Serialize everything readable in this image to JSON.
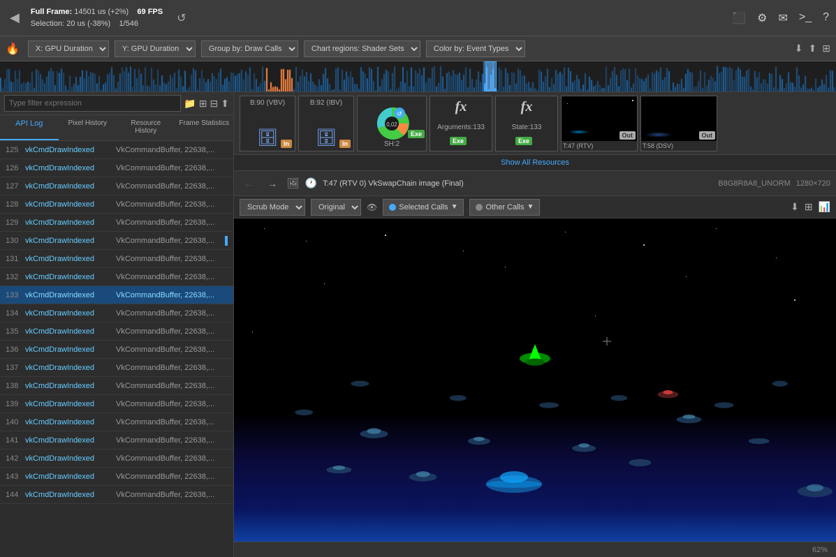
{
  "toolbar": {
    "back_icon": "◀",
    "full_frame_label": "Full Frame:",
    "full_frame_value": "14501 us (+2%)",
    "fps_value": "69 FPS",
    "selection_label": "Selection:",
    "selection_value": "20 us (-38%)",
    "frame_count": "1/546",
    "reset_icon": "↺",
    "icons": [
      "⬜",
      "⚙",
      "✉",
      "▶",
      "?"
    ]
  },
  "axis_toolbar": {
    "flame_icon": "🔥",
    "x_label": "X: GPU Duration",
    "y_label": "Y: GPU Duration",
    "group_label": "Group by: Draw Calls",
    "chart_label": "Chart regions: Shader Sets",
    "color_label": "Color by: Event Types",
    "export_icons": [
      "⬇",
      "⬇",
      "⬜"
    ]
  },
  "left_panel": {
    "filter_placeholder": "Type filter expression",
    "filter_icons": [
      "📁",
      "⊞",
      "⊟",
      "⬆"
    ],
    "tabs": [
      {
        "label": "API Log",
        "active": true
      },
      {
        "label": "Pixel History",
        "active": false
      },
      {
        "label": "Resource History",
        "active": false
      },
      {
        "label": "Frame Statistics",
        "active": false
      }
    ],
    "rows": [
      {
        "num": "125",
        "cmd": "vkCmdDrawIndexed",
        "args": "VkCommandBuffer, 22638,...",
        "selected": false
      },
      {
        "num": "126",
        "cmd": "vkCmdDrawIndexed",
        "args": "VkCommandBuffer, 22638,...",
        "selected": false
      },
      {
        "num": "127",
        "cmd": "vkCmdDrawIndexed",
        "args": "VkCommandBuffer, 22638,...",
        "selected": false
      },
      {
        "num": "128",
        "cmd": "vkCmdDrawIndexed",
        "args": "VkCommandBuffer, 22638,...",
        "selected": false
      },
      {
        "num": "129",
        "cmd": "vkCmdDrawIndexed",
        "args": "VkCommandBuffer, 22638,...",
        "selected": false
      },
      {
        "num": "130",
        "cmd": "vkCmdDrawIndexed",
        "args": "VkCommandBuffer, 22638,...",
        "selected": false
      },
      {
        "num": "131",
        "cmd": "vkCmdDrawIndexed",
        "args": "VkCommandBuffer, 22638,...",
        "selected": false
      },
      {
        "num": "132",
        "cmd": "vkCmdDrawIndexed",
        "args": "VkCommandBuffer, 22638,...",
        "selected": false
      },
      {
        "num": "133",
        "cmd": "vkCmdDrawIndexed",
        "args": "VkCommandBuffer, 22638,...",
        "selected": true
      },
      {
        "num": "134",
        "cmd": "vkCmdDrawIndexed",
        "args": "VkCommandBuffer, 22638,...",
        "selected": false
      },
      {
        "num": "135",
        "cmd": "vkCmdDrawIndexed",
        "args": "VkCommandBuffer, 22638,...",
        "selected": false
      },
      {
        "num": "136",
        "cmd": "vkCmdDrawIndexed",
        "args": "VkCommandBuffer, 22638,...",
        "selected": false
      },
      {
        "num": "137",
        "cmd": "vkCmdDrawIndexed",
        "args": "VkCommandBuffer, 22638,...",
        "selected": false
      },
      {
        "num": "138",
        "cmd": "vkCmdDrawIndexed",
        "args": "VkCommandBuffer, 22638,...",
        "selected": false
      },
      {
        "num": "139",
        "cmd": "vkCmdDrawIndexed",
        "args": "VkCommandBuffer, 22638,...",
        "selected": false
      },
      {
        "num": "140",
        "cmd": "vkCmdDrawIndexed",
        "args": "VkCommandBuffer, 22638,...",
        "selected": false
      },
      {
        "num": "141",
        "cmd": "vkCmdDrawIndexed",
        "args": "VkCommandBuffer, 22638,...",
        "selected": false
      },
      {
        "num": "142",
        "cmd": "vkCmdDrawIndexed",
        "args": "VkCommandBuffer, 22638,...",
        "selected": false
      },
      {
        "num": "143",
        "cmd": "vkCmdDrawIndexed",
        "args": "VkCommandBuffer, 22638,...",
        "selected": false
      },
      {
        "num": "144",
        "cmd": "vkCmdDrawIndexed",
        "args": "VkCommandBuffer, 22638,...",
        "selected": false
      }
    ]
  },
  "resource_bar": {
    "items": [
      {
        "type": "buffer",
        "label": "B:90 (VBV)",
        "badge": "In",
        "badge_type": "in"
      },
      {
        "type": "buffer",
        "label": "B:92 (IBV)",
        "badge": "In",
        "badge_type": "in"
      },
      {
        "type": "pie",
        "label": "SH:2",
        "badge": "Exe",
        "badge_type": "exe",
        "value": "0,02"
      },
      {
        "type": "fx",
        "label": "Arguments:133",
        "badge": "Exe",
        "badge_type": "exe"
      },
      {
        "type": "fx",
        "label": "State:133",
        "badge": "Exe",
        "badge_type": "exe"
      },
      {
        "type": "thumb",
        "label": "T:47 (RTV)",
        "badge": "Out",
        "badge_type": "out"
      },
      {
        "type": "thumb",
        "label": "T:58 (DSV)",
        "badge": "Out",
        "badge_type": "out"
      }
    ],
    "show_all_label": "Show All Resources"
  },
  "viewer": {
    "nav_back": "←",
    "nav_forward": "→",
    "photo_icon": "🖼",
    "clock_icon": "🕐",
    "title": "T:47 (RTV 0) VkSwapChain image (Final)",
    "format": "B8G8R8A8_UNORM",
    "dimensions": "1280×720",
    "scrub_mode_label": "Scrub Mode",
    "original_label": "Original",
    "selected_calls_label": "Selected Calls",
    "other_calls_label": "Other Calls",
    "zoom_level": "62%",
    "export_icons": [
      "⬇",
      "⊞",
      "📊"
    ]
  }
}
